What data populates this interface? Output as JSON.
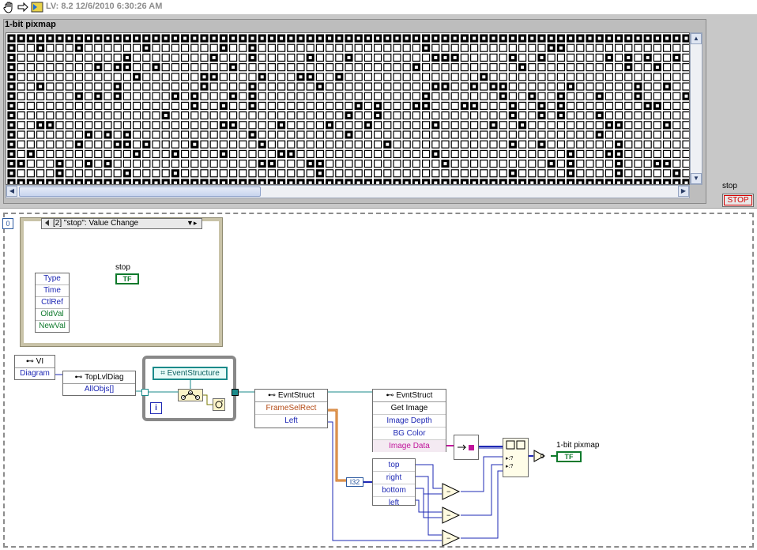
{
  "toolbar": {
    "version": "LV: 8.2 12/6/2010 6:30:26 AM",
    "icons": [
      "hand-icon",
      "arrow-icon",
      "vi-icon"
    ]
  },
  "front_panel": {
    "pixmap_label": "1-bit pixmap",
    "stop_label": "stop",
    "stop_button": "STOP"
  },
  "diagram": {
    "loop_count": "0",
    "event_case": "[2] \"stop\": Value Change",
    "event_data": [
      "Type",
      "Time",
      "CtlRef",
      "OldVal",
      "NewVal"
    ],
    "stop_terminal_label": "stop",
    "tf_text": "TF",
    "vi_ref": {
      "title": "VI",
      "item": "Diagram"
    },
    "toplvl": {
      "title": "TopLvlDiag",
      "item": "AllObjs[]"
    },
    "evstruct_const": "EventStructure",
    "index_i": "i",
    "evntstruct1": {
      "title": "EvntStruct",
      "items": [
        "FrameSelRect",
        "Left"
      ]
    },
    "evntstruct2": {
      "title": "EvntStruct",
      "items": [
        "Get Image",
        "Image Depth",
        "BG Color",
        "Image Data"
      ]
    },
    "i32": "I32",
    "rect": [
      "top",
      "right",
      "bottom",
      "left"
    ],
    "zero": "0",
    "pixmap_terminal": "1-bit pixmap"
  },
  "colors": {
    "blue_wire": "#1e28b4",
    "teal_wire": "#1a8a8a",
    "orange_wire": "#c86414",
    "pink_wire": "#c0149b"
  }
}
